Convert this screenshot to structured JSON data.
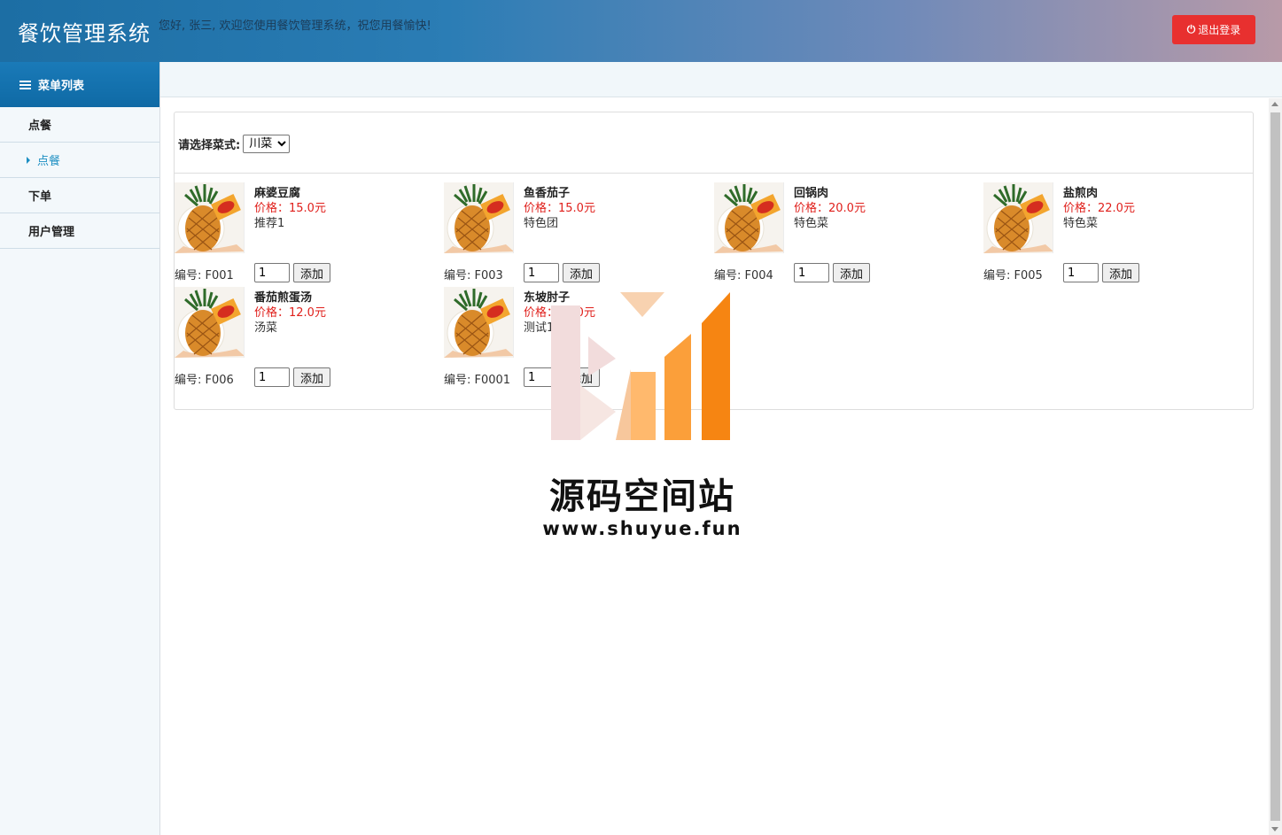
{
  "header": {
    "title": "餐饮管理系统",
    "welcome": "您好, 张三, 欢迎您使用餐饮管理系统，祝您用餐愉快!",
    "logout_label": "退出登录"
  },
  "sidebar": {
    "heading": "菜单列表",
    "items": [
      {
        "label": "点餐"
      },
      {
        "label": "点餐"
      },
      {
        "label": "下单"
      },
      {
        "label": "用户管理"
      }
    ]
  },
  "filter": {
    "label": "请选择菜式:",
    "selected": "川菜"
  },
  "dishes": [
    {
      "name": "麻婆豆腐",
      "price": "价格：15.0元",
      "desc": "推荐1",
      "code": "编号: F001",
      "qty": "1",
      "add_label": "添加"
    },
    {
      "name": "鱼香茄子",
      "price": "价格：15.0元",
      "desc": "特色团",
      "code": "编号: F003",
      "qty": "1",
      "add_label": "添加"
    },
    {
      "name": "回锅肉",
      "price": "价格：20.0元",
      "desc": "特色菜",
      "code": "编号: F004",
      "qty": "1",
      "add_label": "添加"
    },
    {
      "name": "盐煎肉",
      "price": "价格：22.0元",
      "desc": "特色菜",
      "code": "编号: F005",
      "qty": "1",
      "add_label": "添加"
    },
    {
      "name": "番茄煎蛋汤",
      "price": "价格：12.0元",
      "desc": "汤菜",
      "code": "编号: F006",
      "qty": "1",
      "add_label": "添加"
    },
    {
      "name": "东坡肘子",
      "price": "价格：30.0元",
      "desc": "测试1",
      "code": "编号: F0001",
      "qty": "1",
      "add_label": "添加"
    }
  ],
  "watermark": {
    "title": "源码空间站",
    "url": "www.shuyue.fun"
  },
  "colors": {
    "logout": "#e8302f",
    "price": "#e0201c",
    "sidebar_accent": "#1b8ec2"
  }
}
